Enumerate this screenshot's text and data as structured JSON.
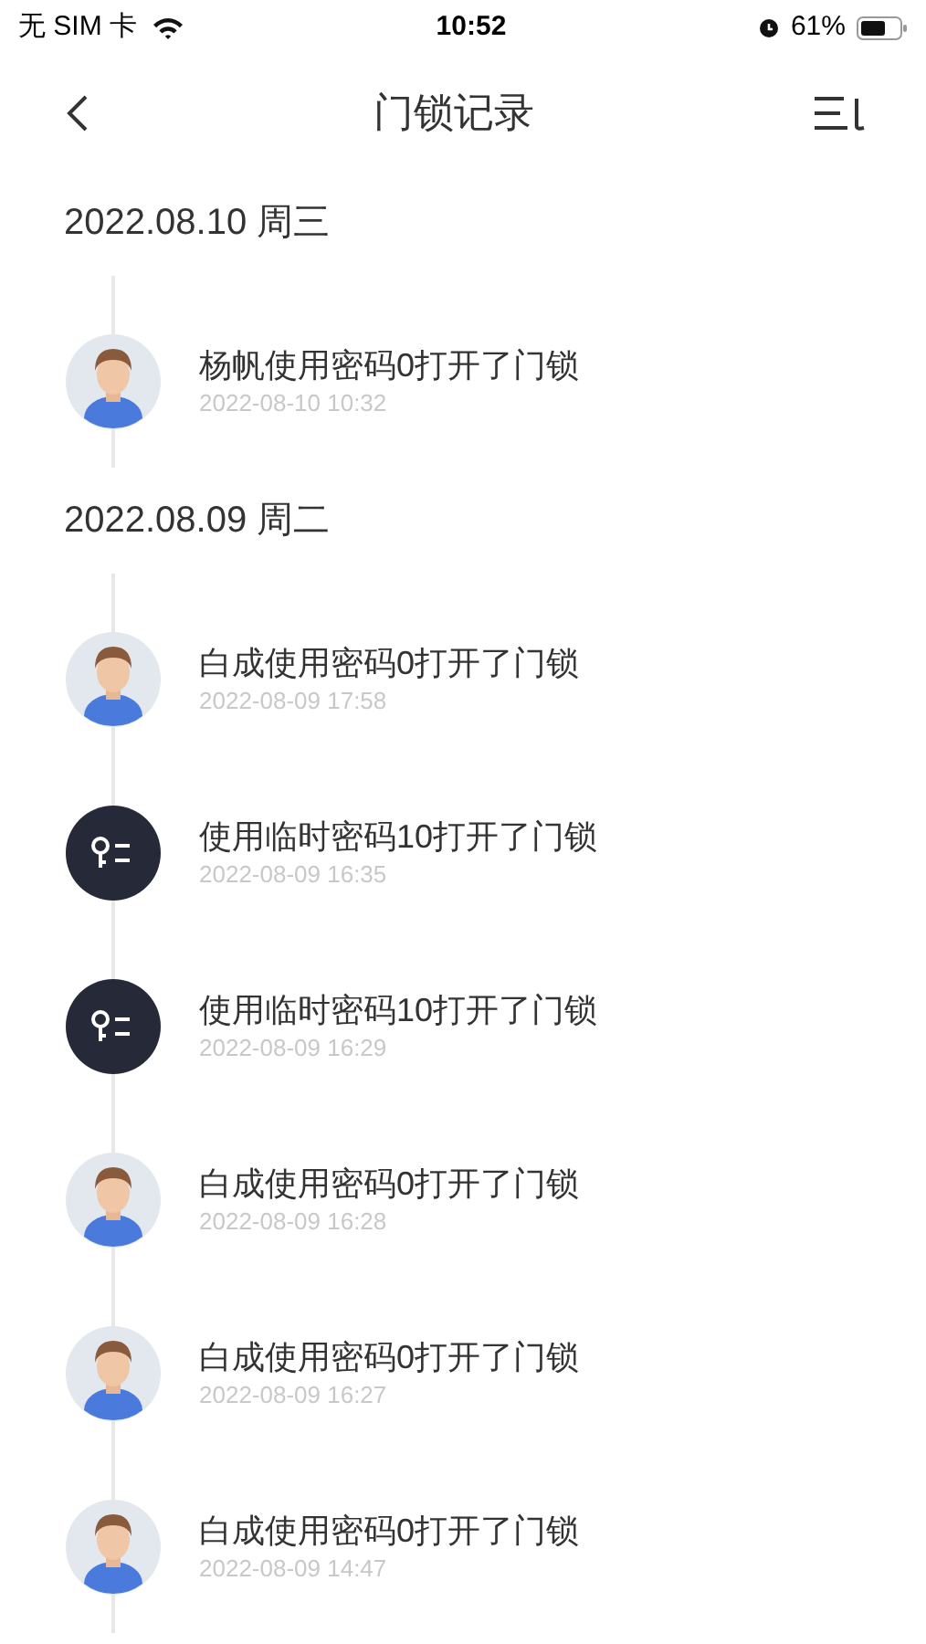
{
  "status_bar": {
    "carrier": "无 SIM 卡",
    "time": "10:52",
    "battery": "61%"
  },
  "nav": {
    "title": "门锁记录"
  },
  "groups": [
    {
      "date": "2022.08.10 周三",
      "records": [
        {
          "kind": "user",
          "text": "杨帆使用密码0打开了门锁",
          "time": "2022-08-10 10:32"
        }
      ]
    },
    {
      "date": "2022.08.09 周二",
      "records": [
        {
          "kind": "user",
          "text": "白成使用密码0打开了门锁",
          "time": "2022-08-09 17:58"
        },
        {
          "kind": "temp_key",
          "text": "使用临时密码10打开了门锁",
          "time": "2022-08-09 16:35"
        },
        {
          "kind": "temp_key",
          "text": "使用临时密码10打开了门锁",
          "time": "2022-08-09 16:29"
        },
        {
          "kind": "user",
          "text": "白成使用密码0打开了门锁",
          "time": "2022-08-09 16:28"
        },
        {
          "kind": "user",
          "text": "白成使用密码0打开了门锁",
          "time": "2022-08-09 16:27"
        },
        {
          "kind": "user",
          "text": "白成使用密码0打开了门锁",
          "time": "2022-08-09 14:47"
        }
      ]
    }
  ]
}
